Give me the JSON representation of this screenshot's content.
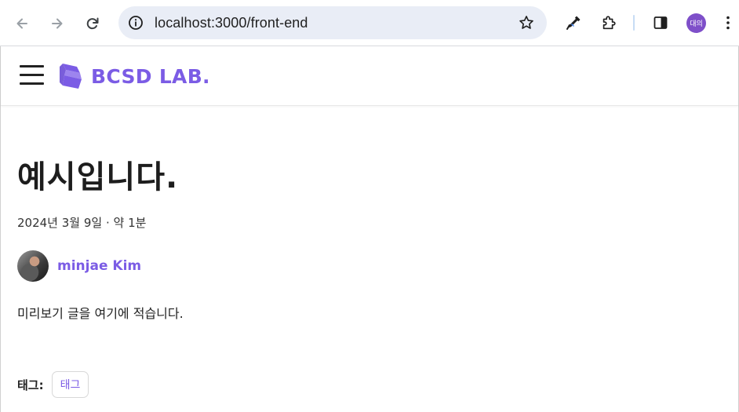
{
  "browser": {
    "url": "localhost:3000/front-end",
    "profile_initials": "대의"
  },
  "site": {
    "logo_text": "BCSD LAB.",
    "brand_color": "#7b5ce5"
  },
  "post": {
    "title": "예시입니다.",
    "meta": "2024년 3월 9일 · 약 1분",
    "author_name": "minjae Kim",
    "preview": "미리보기 글을 여기에 적습니다.",
    "tags_label": "태그:",
    "tags": [
      "태그"
    ]
  },
  "icons": {
    "back": "arrow-left-icon",
    "forward": "arrow-right-icon",
    "reload": "reload-icon",
    "site_info": "info-icon",
    "bookmark": "star-icon",
    "eyedropper": "eyedropper-icon",
    "extensions": "puzzle-icon",
    "side_panel": "side-panel-icon",
    "menu": "kebab-menu-icon",
    "hamburger": "hamburger-icon"
  }
}
